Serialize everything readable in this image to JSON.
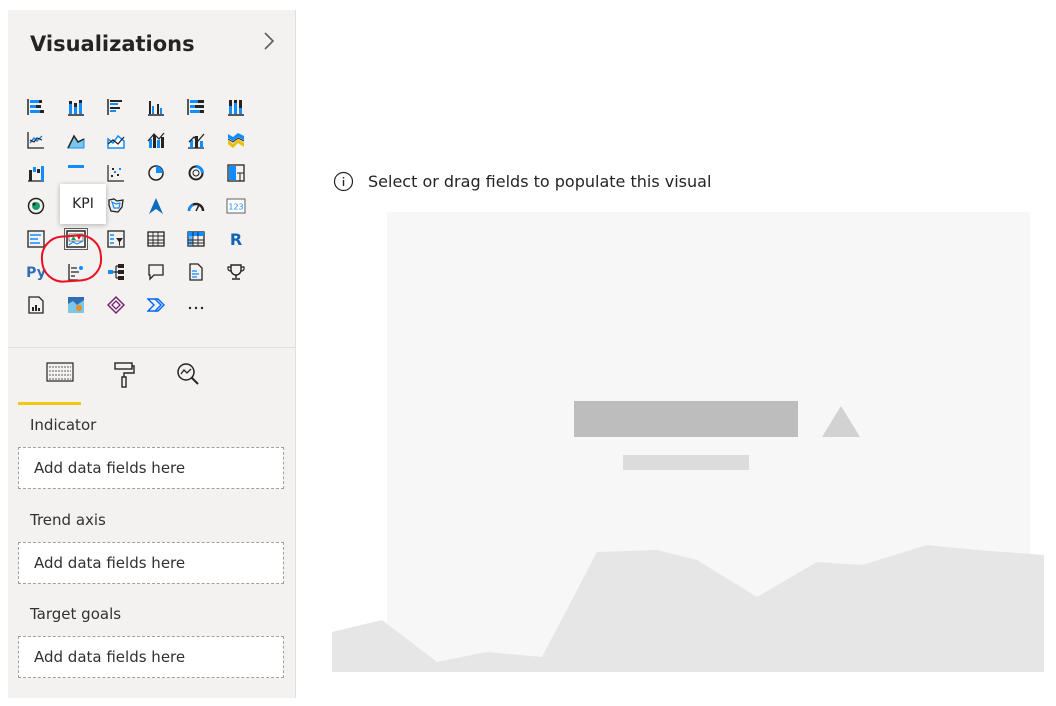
{
  "pane": {
    "title": "Visualizations",
    "collapse_icon": "chevron-right-icon"
  },
  "visuals": [
    "stacked-bar-chart-icon",
    "stacked-column-chart-icon",
    "clustered-bar-chart-icon",
    "clustered-column-chart-icon",
    "100-stacked-bar-chart-icon",
    "100-stacked-column-chart-icon",
    "line-chart-icon",
    "area-chart-icon",
    "stacked-area-chart-icon",
    "line-and-stacked-column-chart-icon",
    "line-and-clustered-column-chart-icon",
    "ribbon-chart-icon",
    "waterfall-chart-icon",
    "funnel-chart-icon",
    "scatter-chart-icon",
    "pie-chart-icon",
    "donut-chart-icon",
    "treemap-icon",
    "map-icon",
    "filled-map-icon",
    "shape-map-icon",
    "azure-map-icon",
    "gauge-icon",
    "card-icon",
    "multi-row-card-icon",
    "kpi-icon",
    "slicer-icon",
    "table-icon",
    "matrix-icon",
    "r-script-visual-icon",
    "python-visual-icon",
    "key-influencers-icon",
    "decomposition-tree-icon",
    "q-and-a-icon",
    "smart-narrative-icon",
    "metrics-icon",
    "paginated-report-icon",
    "arcgis-map-icon",
    "power-apps-icon",
    "power-automate-icon",
    "more-visuals-icon"
  ],
  "tooltip": {
    "text": "KPI"
  },
  "tabs": [
    "fields-icon",
    "format-paint-roller-icon",
    "analytics-magnifier-icon"
  ],
  "wells": [
    {
      "label": "Indicator",
      "placeholder": "Add data fields here"
    },
    {
      "label": "Trend axis",
      "placeholder": "Add data fields here"
    },
    {
      "label": "Target goals",
      "placeholder": "Add data fields here"
    }
  ],
  "canvas": {
    "hint_text": "Select or drag fields to populate this visual",
    "hint_icon": "info-icon"
  },
  "colors": {
    "accent_yellow": "#f2c811",
    "highlight_red": "#e81123",
    "pane_background": "#f3f2f1",
    "placeholder_area": "#e5e5e5"
  }
}
